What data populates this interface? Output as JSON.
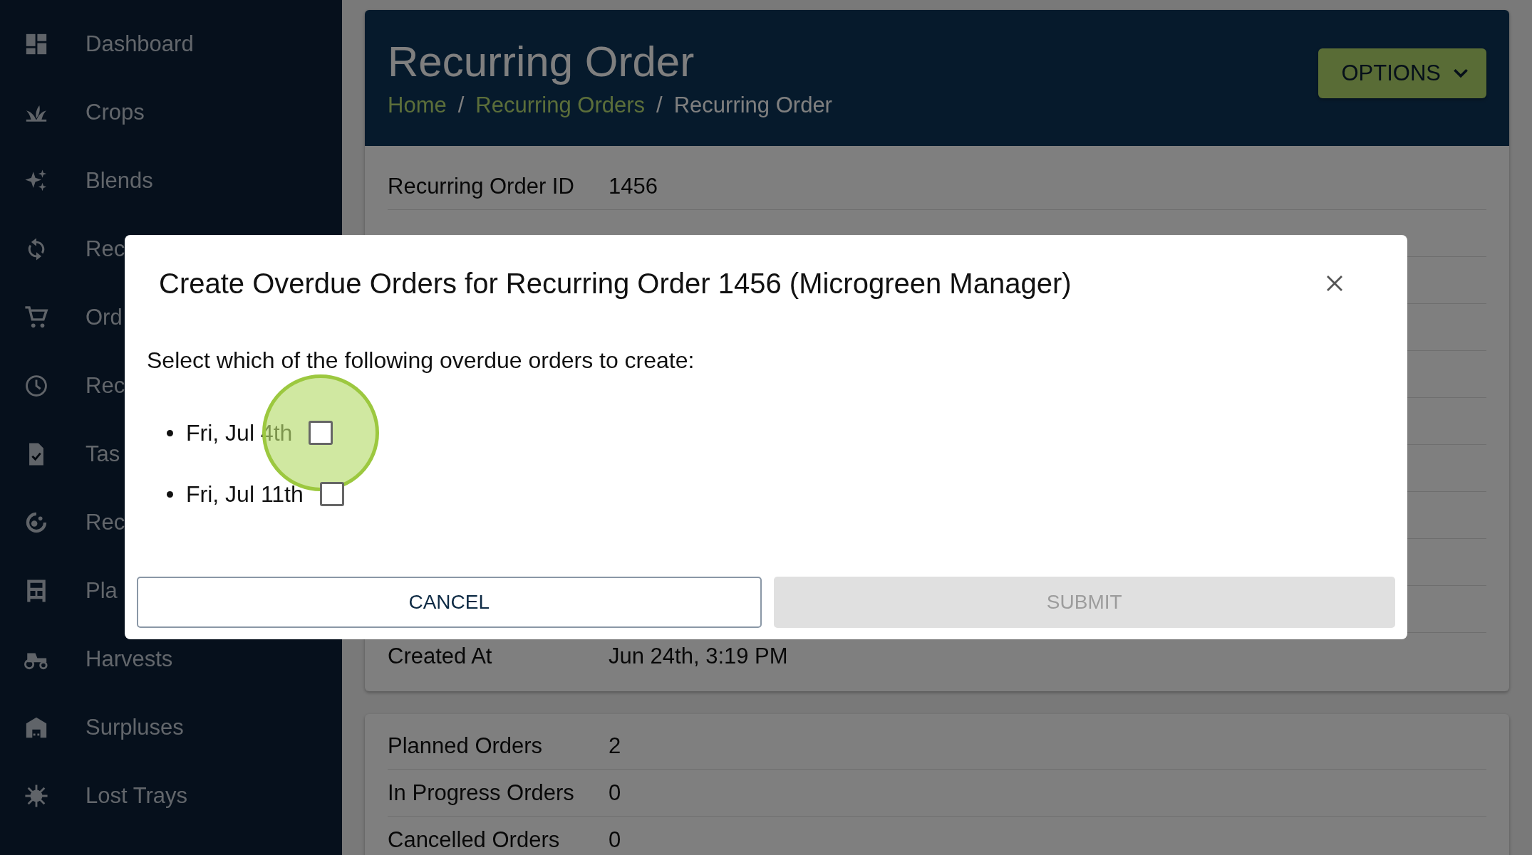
{
  "sidebar": {
    "items": [
      {
        "label": "Dashboard"
      },
      {
        "label": "Crops"
      },
      {
        "label": "Blends"
      },
      {
        "label": "Rec"
      },
      {
        "label": "Ord"
      },
      {
        "label": "Rec"
      },
      {
        "label": "Tas"
      },
      {
        "label": "Rec"
      },
      {
        "label": "Pla"
      },
      {
        "label": "Harvests"
      },
      {
        "label": "Surpluses"
      },
      {
        "label": "Lost Trays"
      }
    ]
  },
  "header": {
    "title": "Recurring Order",
    "breadcrumb": [
      {
        "label": "Home",
        "link": true
      },
      {
        "label": "Recurring Orders",
        "link": true
      },
      {
        "label": "Recurring Order",
        "link": false
      }
    ],
    "separator": "/",
    "options_button": "OPTIONS"
  },
  "details": [
    {
      "label": "Recurring Order ID",
      "value": "1456"
    },
    {
      "label": "Created At",
      "value": "Jun 24th, 3:19 PM"
    }
  ],
  "stats": [
    {
      "label": "Planned Orders",
      "value": "2"
    },
    {
      "label": "In Progress Orders",
      "value": "0"
    },
    {
      "label": "Cancelled Orders",
      "value": "0"
    }
  ],
  "modal": {
    "title": "Create Overdue Orders for Recurring Order 1456 (Microgreen Manager)",
    "prompt": "Select which of the following overdue orders to create:",
    "items": [
      {
        "label": "Fri, Jul 4th",
        "checked": false,
        "tapped": true
      },
      {
        "label": "Fri, Jul 11th",
        "checked": false,
        "tapped": false
      }
    ],
    "cancel": "CANCEL",
    "submit": "SUBMIT",
    "submit_disabled": true
  }
}
